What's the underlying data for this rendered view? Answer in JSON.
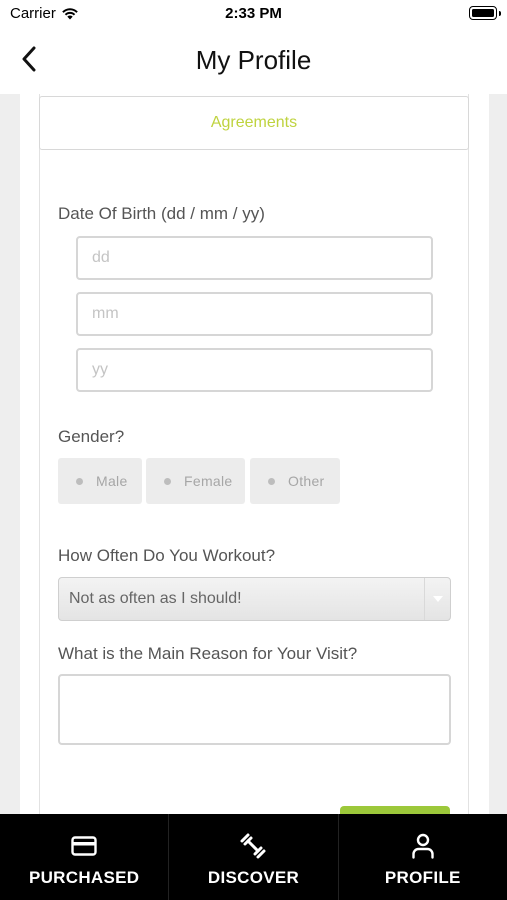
{
  "status_bar": {
    "carrier": "Carrier",
    "time": "2:33 PM"
  },
  "header": {
    "title": "My Profile",
    "back_icon": "chevron-left-icon"
  },
  "form": {
    "agreements_tab": "Agreements",
    "dob": {
      "label": "Date Of Birth (dd / mm / yy)",
      "day_placeholder": "dd",
      "month_placeholder": "mm",
      "year_placeholder": "yy"
    },
    "gender": {
      "label": "Gender?",
      "options": [
        "Male",
        "Female",
        "Other"
      ]
    },
    "workout": {
      "label": "How Often Do You Workout?",
      "selected": "Not as often as I should!"
    },
    "visit_reason": {
      "label": "What is the Main Reason for Your Visit?",
      "value": ""
    }
  },
  "tab_bar": {
    "items": [
      {
        "label": "PURCHASED",
        "icon": "credit-card-icon"
      },
      {
        "label": "DISCOVER",
        "icon": "dumbbell-icon"
      },
      {
        "label": "PROFILE",
        "icon": "person-icon"
      }
    ]
  },
  "colors": {
    "accent_green": "#bfd33f",
    "button_green": "#9cc83a",
    "tab_bar_bg": "#000000"
  }
}
